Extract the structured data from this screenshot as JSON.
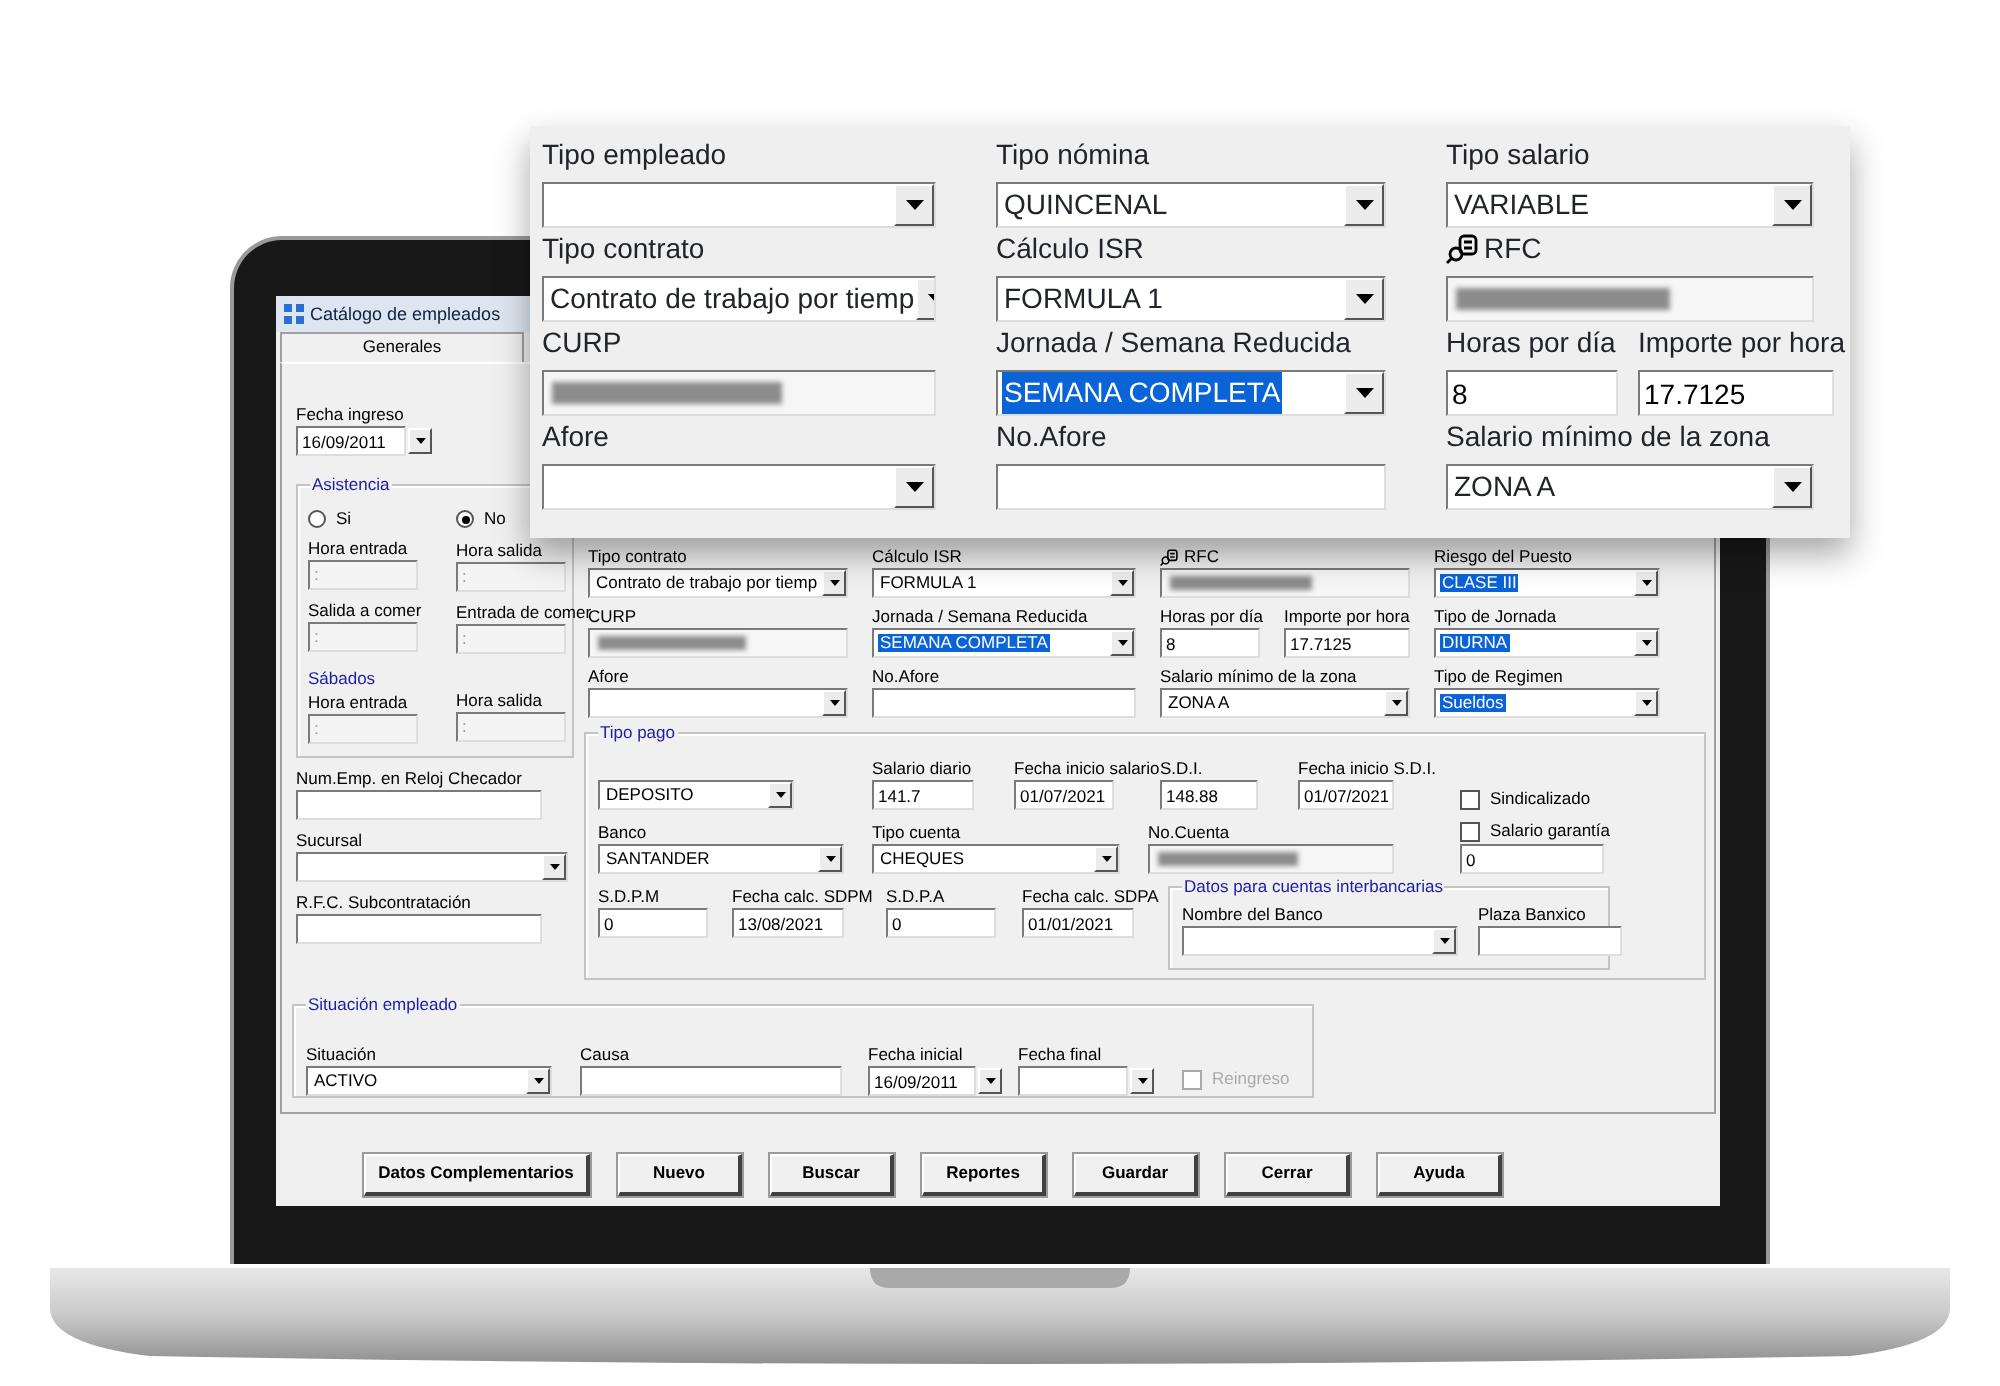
{
  "window": {
    "title": "Catálogo de empleados"
  },
  "tabs": [
    {
      "label": "Generales",
      "selected": true
    }
  ],
  "overlay": {
    "rows": [
      [
        {
          "label": "Tipo empleado",
          "kind": "combo"
        },
        {
          "label": "Tipo nómina",
          "kind": "combo",
          "value": "QUINCENAL",
          "highlighted": false
        },
        {
          "label": "Tipo salario",
          "kind": "combo",
          "value": "VARIABLE",
          "highlighted": false
        }
      ],
      [
        {
          "label": "Tipo contrato",
          "kind": "combo",
          "value": "Contrato de trabajo por tiemp",
          "highlighted": false
        },
        {
          "label": "Cálculo ISR",
          "kind": "combo",
          "value": "FORMULA 1",
          "highlighted": false
        },
        {
          "label": "RFC",
          "kind": "lookup"
        }
      ],
      [
        {
          "label": "CURP",
          "kind": "redacted"
        },
        {
          "label": "Jornada / Semana Reducida",
          "kind": "combo",
          "value": "SEMANA COMPLETA",
          "highlighted": true
        },
        {
          "label": "Horas por día",
          "kind": "short",
          "value": "8"
        },
        {
          "label": "Importe por hora",
          "kind": "short",
          "value": "17.7125"
        }
      ],
      [
        {
          "label": "Afore",
          "kind": "combo"
        },
        {
          "label": "No.Afore",
          "kind": "text"
        },
        {
          "label": "Salario mínimo de la zona",
          "kind": "combo",
          "value": "ZONA A",
          "highlighted": false
        }
      ]
    ]
  },
  "ingreso": {
    "label": "Fecha ingreso",
    "kind": "date",
    "value": "16/09/2011"
  },
  "asistencia": {
    "legend": "Asistencia",
    "options": [
      {
        "label": "Si",
        "selected": false
      },
      {
        "label": "No",
        "selected": true
      }
    ],
    "fields": [
      {
        "label": "Hora entrada",
        "kind": "time",
        "value": ":",
        "disabled": true
      },
      {
        "label": "Hora salida",
        "kind": "time",
        "value": ":",
        "disabled": true
      },
      {
        "label": "Salida a comer",
        "kind": "time",
        "value": ":",
        "disabled": true
      },
      {
        "label": "Entrada de comer",
        "kind": "time",
        "value": ":",
        "disabled": true
      }
    ],
    "sabados": {
      "title": "Sábados",
      "fields": [
        {
          "label": "Hora entrada",
          "kind": "time",
          "value": ":",
          "disabled": true
        },
        {
          "label": "Hora salida",
          "kind": "time",
          "value": ":",
          "disabled": true
        }
      ]
    }
  },
  "left_fields": [
    {
      "label": "Num.Emp. en Reloj Checador",
      "kind": "text"
    },
    {
      "label": "Sucursal",
      "kind": "combo"
    },
    {
      "label": "R.F.C. Subcontratación",
      "kind": "text"
    }
  ],
  "upper_rows": [
    [
      {
        "label": "Tipo contrato",
        "kind": "combo",
        "value": "Contrato de trabajo por tiemp",
        "highlighted": false
      },
      {
        "label": "Cálculo ISR",
        "kind": "combo",
        "value": "FORMULA 1",
        "highlighted": false
      },
      {
        "label": "RFC",
        "kind": "lookup"
      },
      {
        "label": "Riesgo del Puesto",
        "kind": "combo",
        "value": "CLASE III",
        "highlighted": true
      }
    ],
    [
      {
        "label": "CURP",
        "kind": "redacted"
      },
      {
        "label": "Jornada / Semana Reducida",
        "kind": "combo",
        "value": "SEMANA COMPLETA",
        "highlighted": true
      },
      {
        "label": "Horas por día",
        "kind": "short",
        "value": "8"
      },
      {
        "label": "Importe por hora",
        "kind": "short",
        "value": "17.7125"
      },
      {
        "label": "Tipo de Jornada",
        "kind": "combo",
        "value": "DIURNA",
        "highlighted": true
      }
    ],
    [
      {
        "label": "Afore",
        "kind": "combo"
      },
      {
        "label": "No.Afore",
        "kind": "text"
      },
      {
        "label": "Salario mínimo de la zona",
        "kind": "combo",
        "value": "ZONA A",
        "highlighted": false
      },
      {
        "label": "Tipo de Regimen",
        "kind": "combo",
        "value": "Sueldos",
        "highlighted": true
      }
    ]
  ],
  "tipo_pago": {
    "legend": "Tipo pago",
    "fields": [
      {
        "kind": "combo",
        "value": "DEPOSITO",
        "highlighted": false
      },
      {
        "label": "Salario diario",
        "kind": "text",
        "value": "141.7"
      },
      {
        "label": "Fecha inicio salario",
        "kind": "text",
        "value": "01/07/2021"
      },
      {
        "label": "S.D.I.",
        "kind": "text",
        "value": "148.88"
      },
      {
        "label": "Fecha inicio S.D.I.",
        "kind": "text",
        "value": "01/07/2021"
      },
      {
        "label": "Sindicalizado",
        "kind": "check",
        "checked": false
      },
      {
        "label": "Banco",
        "kind": "combo",
        "value": "SANTANDER",
        "highlighted": false
      },
      {
        "label": "Tipo cuenta",
        "kind": "combo",
        "value": "CHEQUES",
        "highlighted": false
      },
      {
        "label": "No.Cuenta",
        "kind": "redacted"
      },
      {
        "label": "Salario garantía",
        "kind": "check-field",
        "checked": false,
        "value": "0"
      },
      {
        "label": "S.D.P.M",
        "kind": "text",
        "value": "0"
      },
      {
        "label": "Fecha calc. SDPM",
        "kind": "text",
        "value": "13/08/2021"
      },
      {
        "label": "S.D.P.A",
        "kind": "text",
        "value": "0"
      },
      {
        "label": "Fecha calc. SDPA",
        "kind": "text",
        "value": "01/01/2021"
      }
    ],
    "interbank": {
      "kind": "group",
      "legend": "Datos para cuentas interbancarias",
      "fields": [
        {
          "label": "Nombre del Banco",
          "kind": "combo"
        },
        {
          "label": "Plaza Banxico",
          "kind": "text"
        }
      ]
    }
  },
  "situacion": {
    "legend": "Situación empleado",
    "fields": [
      {
        "label": "Situación",
        "kind": "combo",
        "value": "ACTIVO",
        "highlighted": false
      },
      {
        "label": "Causa",
        "kind": "text"
      },
      {
        "label": "Fecha inicial",
        "kind": "date",
        "value": "16/09/2011"
      },
      {
        "label": "Fecha final",
        "kind": "date"
      },
      {
        "label": "Reingreso",
        "kind": "check",
        "checked": false,
        "disabled": true
      }
    ]
  },
  "buttons": [
    "Datos Complementarios",
    "Nuevo",
    "Buscar",
    "Reportes",
    "Guardar",
    "Cerrar",
    "Ayuda"
  ]
}
